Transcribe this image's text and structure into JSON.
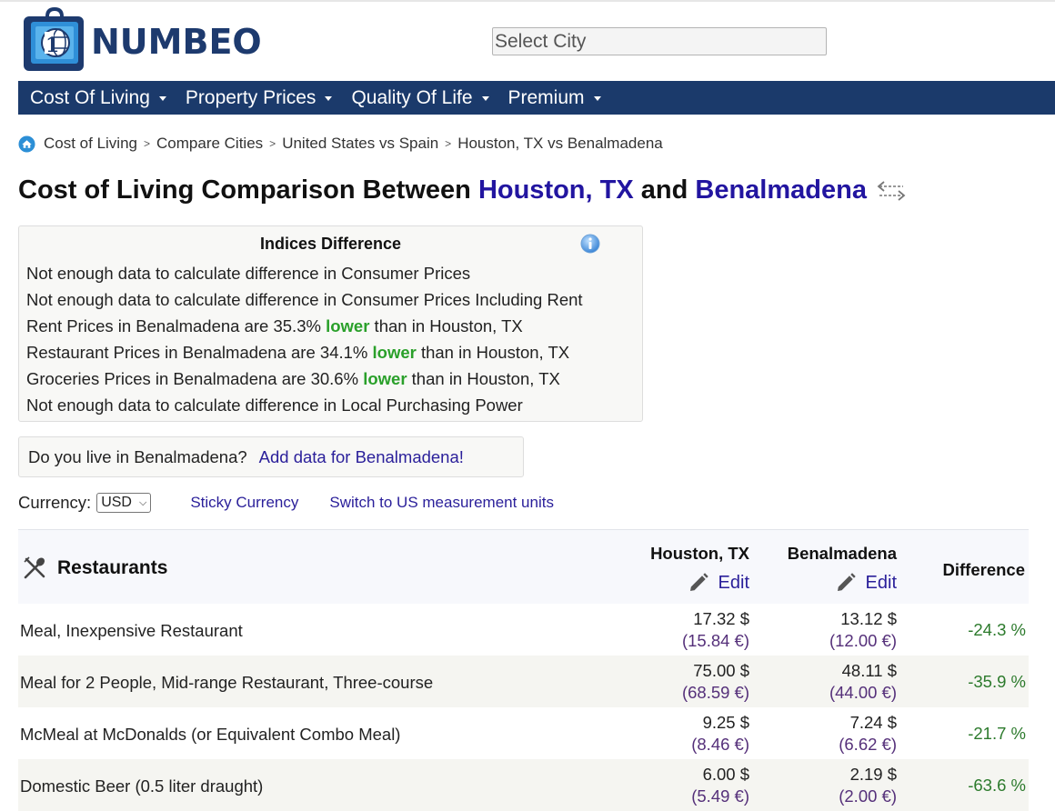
{
  "brand": {
    "name": "NUMBEO"
  },
  "search": {
    "placeholder": "Select City"
  },
  "nav": {
    "items": [
      {
        "label": "Cost Of Living"
      },
      {
        "label": "Property Prices"
      },
      {
        "label": "Quality Of Life"
      },
      {
        "label": "Premium"
      }
    ]
  },
  "breadcrumb": {
    "items": [
      {
        "label": "Cost of Living"
      },
      {
        "label": "Compare Cities"
      },
      {
        "label": "United States vs Spain"
      },
      {
        "label": "Houston, TX vs Benalmadena"
      }
    ],
    "separator": ">"
  },
  "title": {
    "prefix": "Cost of Living Comparison Between ",
    "city1": "Houston, TX",
    "middle": " and ",
    "city2": "Benalmadena"
  },
  "indices": {
    "title": "Indices Difference",
    "lines": [
      {
        "text": "Not enough data to calculate difference in Consumer Prices"
      },
      {
        "text": "Not enough data to calculate difference in Consumer Prices Including Rent"
      },
      {
        "before": "Rent Prices in Benalmadena are 35.3% ",
        "highlight": "lower",
        "after": " than in Houston, TX"
      },
      {
        "before": "Restaurant Prices in Benalmadena are 34.1% ",
        "highlight": "lower",
        "after": " than in Houston, TX"
      },
      {
        "before": "Groceries Prices in Benalmadena are 30.6% ",
        "highlight": "lower",
        "after": " than in Houston, TX"
      },
      {
        "text": "Not enough data to calculate difference in Local Purchasing Power"
      }
    ]
  },
  "live": {
    "question": "Do you live in Benalmadena?",
    "link": "Add data for Benalmadena!"
  },
  "currency": {
    "label": "Currency:",
    "selected": "USD",
    "sticky_link": "Sticky Currency",
    "units_link": "Switch to US measurement units"
  },
  "colors": {
    "nav_bg": "#1b3a6b",
    "link": "#2a1f9a",
    "lower": "#2aa02a",
    "difference": "#2c7a2c",
    "eur": "#55307a"
  },
  "table": {
    "category": "Restaurants",
    "col_city1": "Houston, TX",
    "col_city2": "Benalmadena",
    "edit_label": "Edit",
    "col_diff": "Difference",
    "rows": [
      {
        "item": "Meal, Inexpensive Restaurant",
        "c1_usd": "17.32 $",
        "c1_eur": "(15.84 €)",
        "c2_usd": "13.12 $",
        "c2_eur": "(12.00 €)",
        "diff": "-24.3 %"
      },
      {
        "item": "Meal for 2 People, Mid-range Restaurant, Three-course",
        "c1_usd": "75.00 $",
        "c1_eur": "(68.59 €)",
        "c2_usd": "48.11 $",
        "c2_eur": "(44.00 €)",
        "diff": "-35.9 %"
      },
      {
        "item": "McMeal at McDonalds (or Equivalent Combo Meal)",
        "c1_usd": "9.25 $",
        "c1_eur": "(8.46 €)",
        "c2_usd": "7.24 $",
        "c2_eur": "(6.62 €)",
        "diff": "-21.7 %"
      },
      {
        "item": "Domestic Beer (0.5 liter draught)",
        "c1_usd": "6.00 $",
        "c1_eur": "(5.49 €)",
        "c2_usd": "2.19 $",
        "c2_eur": "(2.00 €)",
        "diff": "-63.6 %"
      }
    ]
  }
}
